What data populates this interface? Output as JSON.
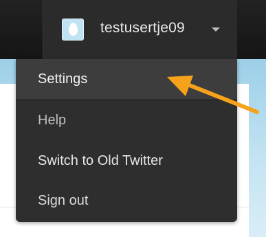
{
  "header": {
    "username": "testusertje09",
    "avatar_icon": "default-egg-avatar",
    "caret_icon": "caret-down-icon"
  },
  "menu": {
    "items": [
      {
        "label": "Settings",
        "active": true
      },
      {
        "label": "Help",
        "active": false
      },
      {
        "label": "Switch to Old Twitter",
        "active": false
      },
      {
        "label": "Sign out",
        "active": false
      }
    ]
  },
  "annotation": {
    "icon": "arrow-pointer",
    "color": "#f7a21b"
  },
  "colors": {
    "topbar": "#1b1b1b",
    "dropdown": "#2e2e2e",
    "active_item": "#3d3d3d",
    "page_blue": "#b5dcef"
  }
}
